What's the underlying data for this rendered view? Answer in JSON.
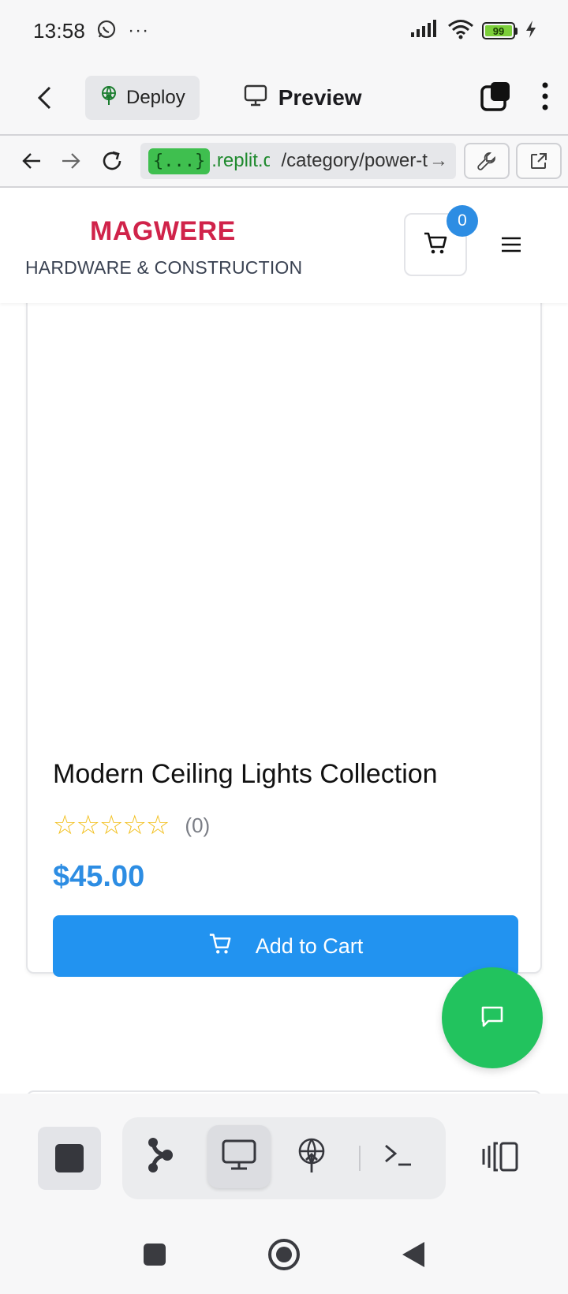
{
  "status_bar": {
    "time": "13:58",
    "more": "···",
    "battery_level": "99"
  },
  "app_bar": {
    "deploy_label": "Deploy",
    "preview_label": "Preview"
  },
  "url_bar": {
    "badge": "{...}",
    "host": ".replit.dev",
    "path": "/category/power-tools",
    "go_arrow": "→"
  },
  "site": {
    "brand_name": "MAGWERE",
    "brand_tagline": "HARDWARE & CONSTRUCTION",
    "cart_count": "0"
  },
  "product": {
    "title": "Modern Ceiling Lights Collection",
    "stars": "☆☆☆☆☆",
    "rating_value": 0,
    "review_count": "(0)",
    "price": "$45.00",
    "add_to_cart_label": "Add to Cart"
  },
  "colors": {
    "brand_red": "#d0234a",
    "accent_blue": "#2293f0",
    "chat_green": "#22c35e",
    "url_green": "#1f8a2e"
  },
  "icons": [
    "whatsapp-icon",
    "signal-icon",
    "wifi-icon",
    "battery-icon",
    "charging-icon",
    "back-chevron-icon",
    "deploy-icon",
    "monitor-icon",
    "tabs-icon",
    "kebab-menu-icon",
    "arrow-left-icon",
    "arrow-right-icon",
    "reload-icon",
    "wrench-icon",
    "external-link-icon",
    "cart-icon",
    "hamburger-icon",
    "chat-icon",
    "stop-icon",
    "git-icon",
    "deploy-globe-icon",
    "terminal-icon",
    "layout-icon"
  ]
}
